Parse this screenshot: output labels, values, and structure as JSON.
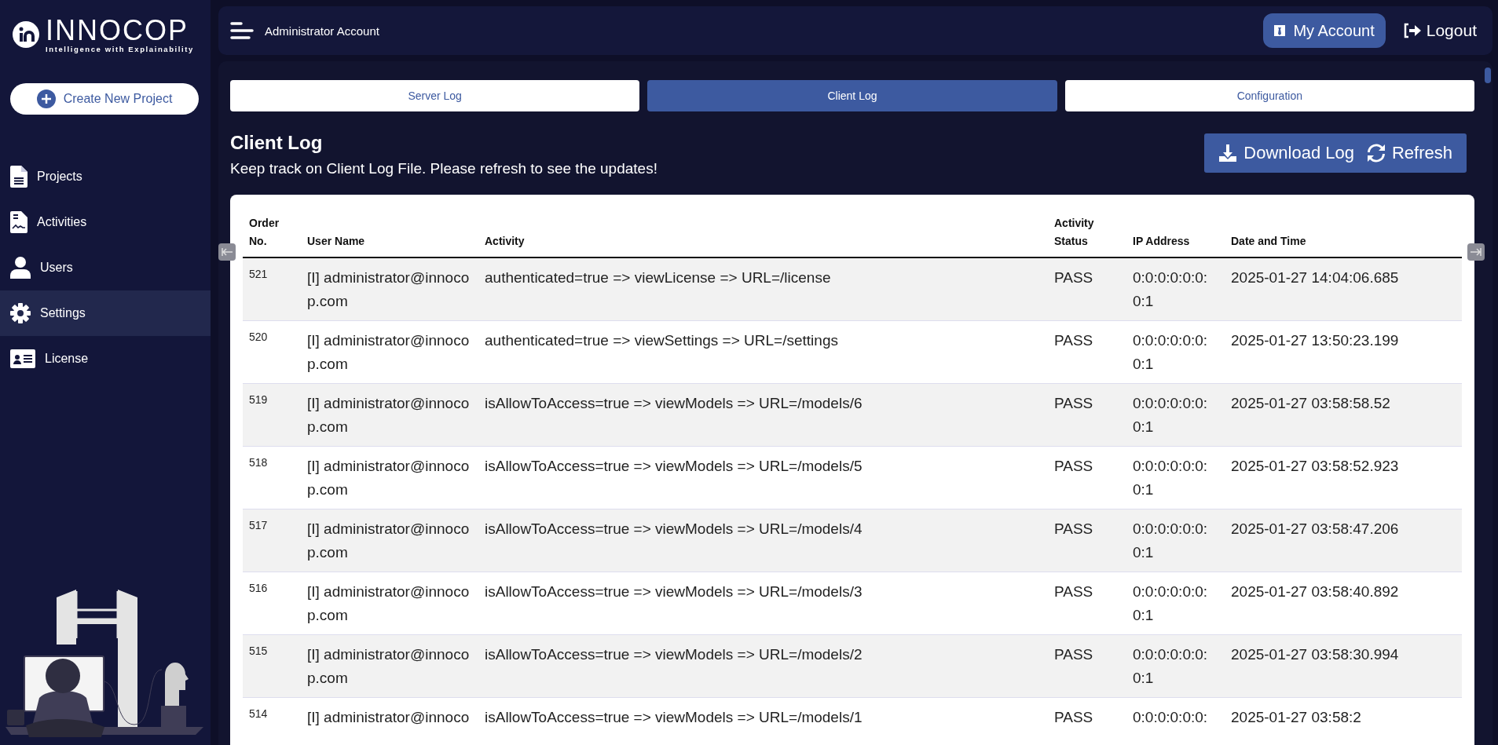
{
  "logo": {
    "name": "INNOCOP",
    "tagline": "Intelligence with Explainability"
  },
  "sidebar": {
    "create_button": "Create New Project",
    "items": [
      {
        "label": "Projects",
        "selected": false
      },
      {
        "label": "Activities",
        "selected": false
      },
      {
        "label": "Users",
        "selected": false
      },
      {
        "label": "Settings",
        "selected": true
      },
      {
        "label": "License",
        "selected": false
      }
    ]
  },
  "header": {
    "title": "Administrator Account",
    "account_button": "My Account",
    "logout_button": "Logout"
  },
  "tabs": [
    {
      "label": "Server Log",
      "selected": false
    },
    {
      "label": "Client Log",
      "selected": true
    },
    {
      "label": "Configuration",
      "selected": false
    }
  ],
  "section": {
    "title": "Client Log",
    "subtitle": "Keep track on Client Log File. Please refresh to see the updates!",
    "download_button": "Download Log",
    "refresh_button": "Refresh"
  },
  "table": {
    "columns": [
      "Order No.",
      "User Name",
      "Activity",
      "Activity Status",
      "IP Address",
      "Date and Time"
    ],
    "rows": [
      [
        "521",
        "[I] administrator@innocop.com",
        "authenticated=true => viewLicense => URL=/license",
        "PASS",
        "0:0:0:0:0:0:0:1",
        "2025-01-27 14:04:06.685"
      ],
      [
        "520",
        "[I] administrator@innocop.com",
        "authenticated=true => viewSettings => URL=/settings",
        "PASS",
        "0:0:0:0:0:0:0:1",
        "2025-01-27 13:50:23.199"
      ],
      [
        "519",
        "[I] administrator@innocop.com",
        "isAllowToAccess=true => viewModels => URL=/models/6",
        "PASS",
        "0:0:0:0:0:0:0:1",
        "2025-01-27 03:58:58.52"
      ],
      [
        "518",
        "[I] administrator@innocop.com",
        "isAllowToAccess=true => viewModels => URL=/models/5",
        "PASS",
        "0:0:0:0:0:0:0:1",
        "2025-01-27 03:58:52.923"
      ],
      [
        "517",
        "[I] administrator@innocop.com",
        "isAllowToAccess=true => viewModels => URL=/models/4",
        "PASS",
        "0:0:0:0:0:0:0:1",
        "2025-01-27 03:58:47.206"
      ],
      [
        "516",
        "[I] administrator@innocop.com",
        "isAllowToAccess=true => viewModels => URL=/models/3",
        "PASS",
        "0:0:0:0:0:0:0:1",
        "2025-01-27 03:58:40.892"
      ],
      [
        "515",
        "[I] administrator@innocop.com",
        "isAllowToAccess=true => viewModels => URL=/models/2",
        "PASS",
        "0:0:0:0:0:0:0:1",
        "2025-01-27 03:58:30.994"
      ],
      [
        "514",
        "[I] administrator@innoco",
        "isAllowToAccess=true => viewModels => URL=/models/1",
        "PASS",
        "0:0:0:0:0:0:",
        "2025-01-27 03:58:2"
      ]
    ]
  }
}
